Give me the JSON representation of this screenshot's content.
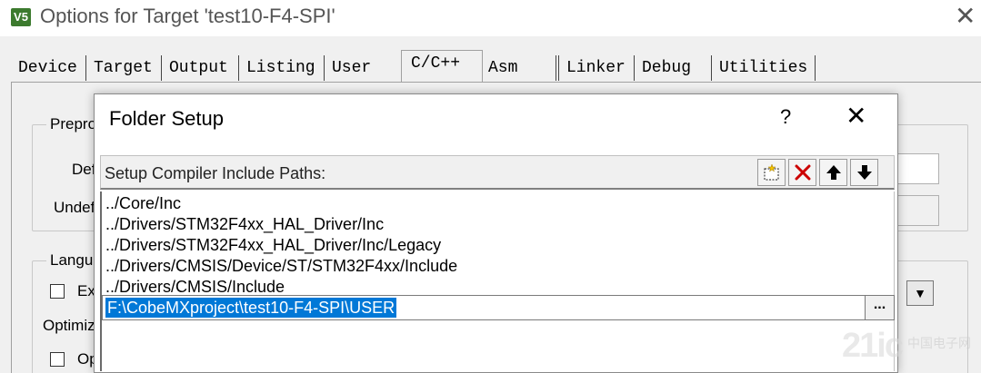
{
  "window": {
    "icon_text": "V5",
    "title": "Options for Target 'test10-F4-SPI'",
    "close_glyph": "✕"
  },
  "tabs": [
    {
      "label": "Device",
      "active": false
    },
    {
      "label": "Target",
      "active": false
    },
    {
      "label": "Output",
      "active": false
    },
    {
      "label": "Listing",
      "active": false
    },
    {
      "label": "User",
      "active": false
    },
    {
      "label": "C/C++",
      "active": true
    },
    {
      "label": "Asm",
      "active": false
    },
    {
      "label": "Linker",
      "active": false
    },
    {
      "label": "Debug",
      "active": false
    },
    {
      "label": "Utilities",
      "active": false
    }
  ],
  "background_panel": {
    "preprocessor_legend": "Prepro",
    "define_label": "Def",
    "undefine_label": "Undef",
    "language_legend": "Langu",
    "ex_label": "Ex",
    "optimize_label": "Optimiz",
    "op_label": "Op",
    "dropdown_glyph": "▼"
  },
  "dialog": {
    "title": "Folder Setup",
    "help_glyph": "?",
    "close_glyph": "✕",
    "toolbar_label": "Setup Compiler Include Paths:",
    "toolbar_icons": [
      "new-folder-icon",
      "delete-icon",
      "move-up-icon",
      "move-down-icon"
    ],
    "paths": [
      "../Core/Inc",
      "../Drivers/STM32F4xx_HAL_Driver/Inc",
      "../Drivers/STM32F4xx_HAL_Driver/Inc/Legacy",
      "../Drivers/CMSIS/Device/ST/STM32F4xx/Include",
      "../Drivers/CMSIS/Include"
    ],
    "edit_value": "F:\\CobeMXproject\\test10-F4-SPI\\USER",
    "browse_label": "..."
  },
  "watermark": {
    "number": "21ic",
    "text": "中国电子网"
  },
  "colors": {
    "selection": "#0078d7",
    "delete_icon": "#cc0000",
    "app_icon": "#3c7a2e"
  }
}
